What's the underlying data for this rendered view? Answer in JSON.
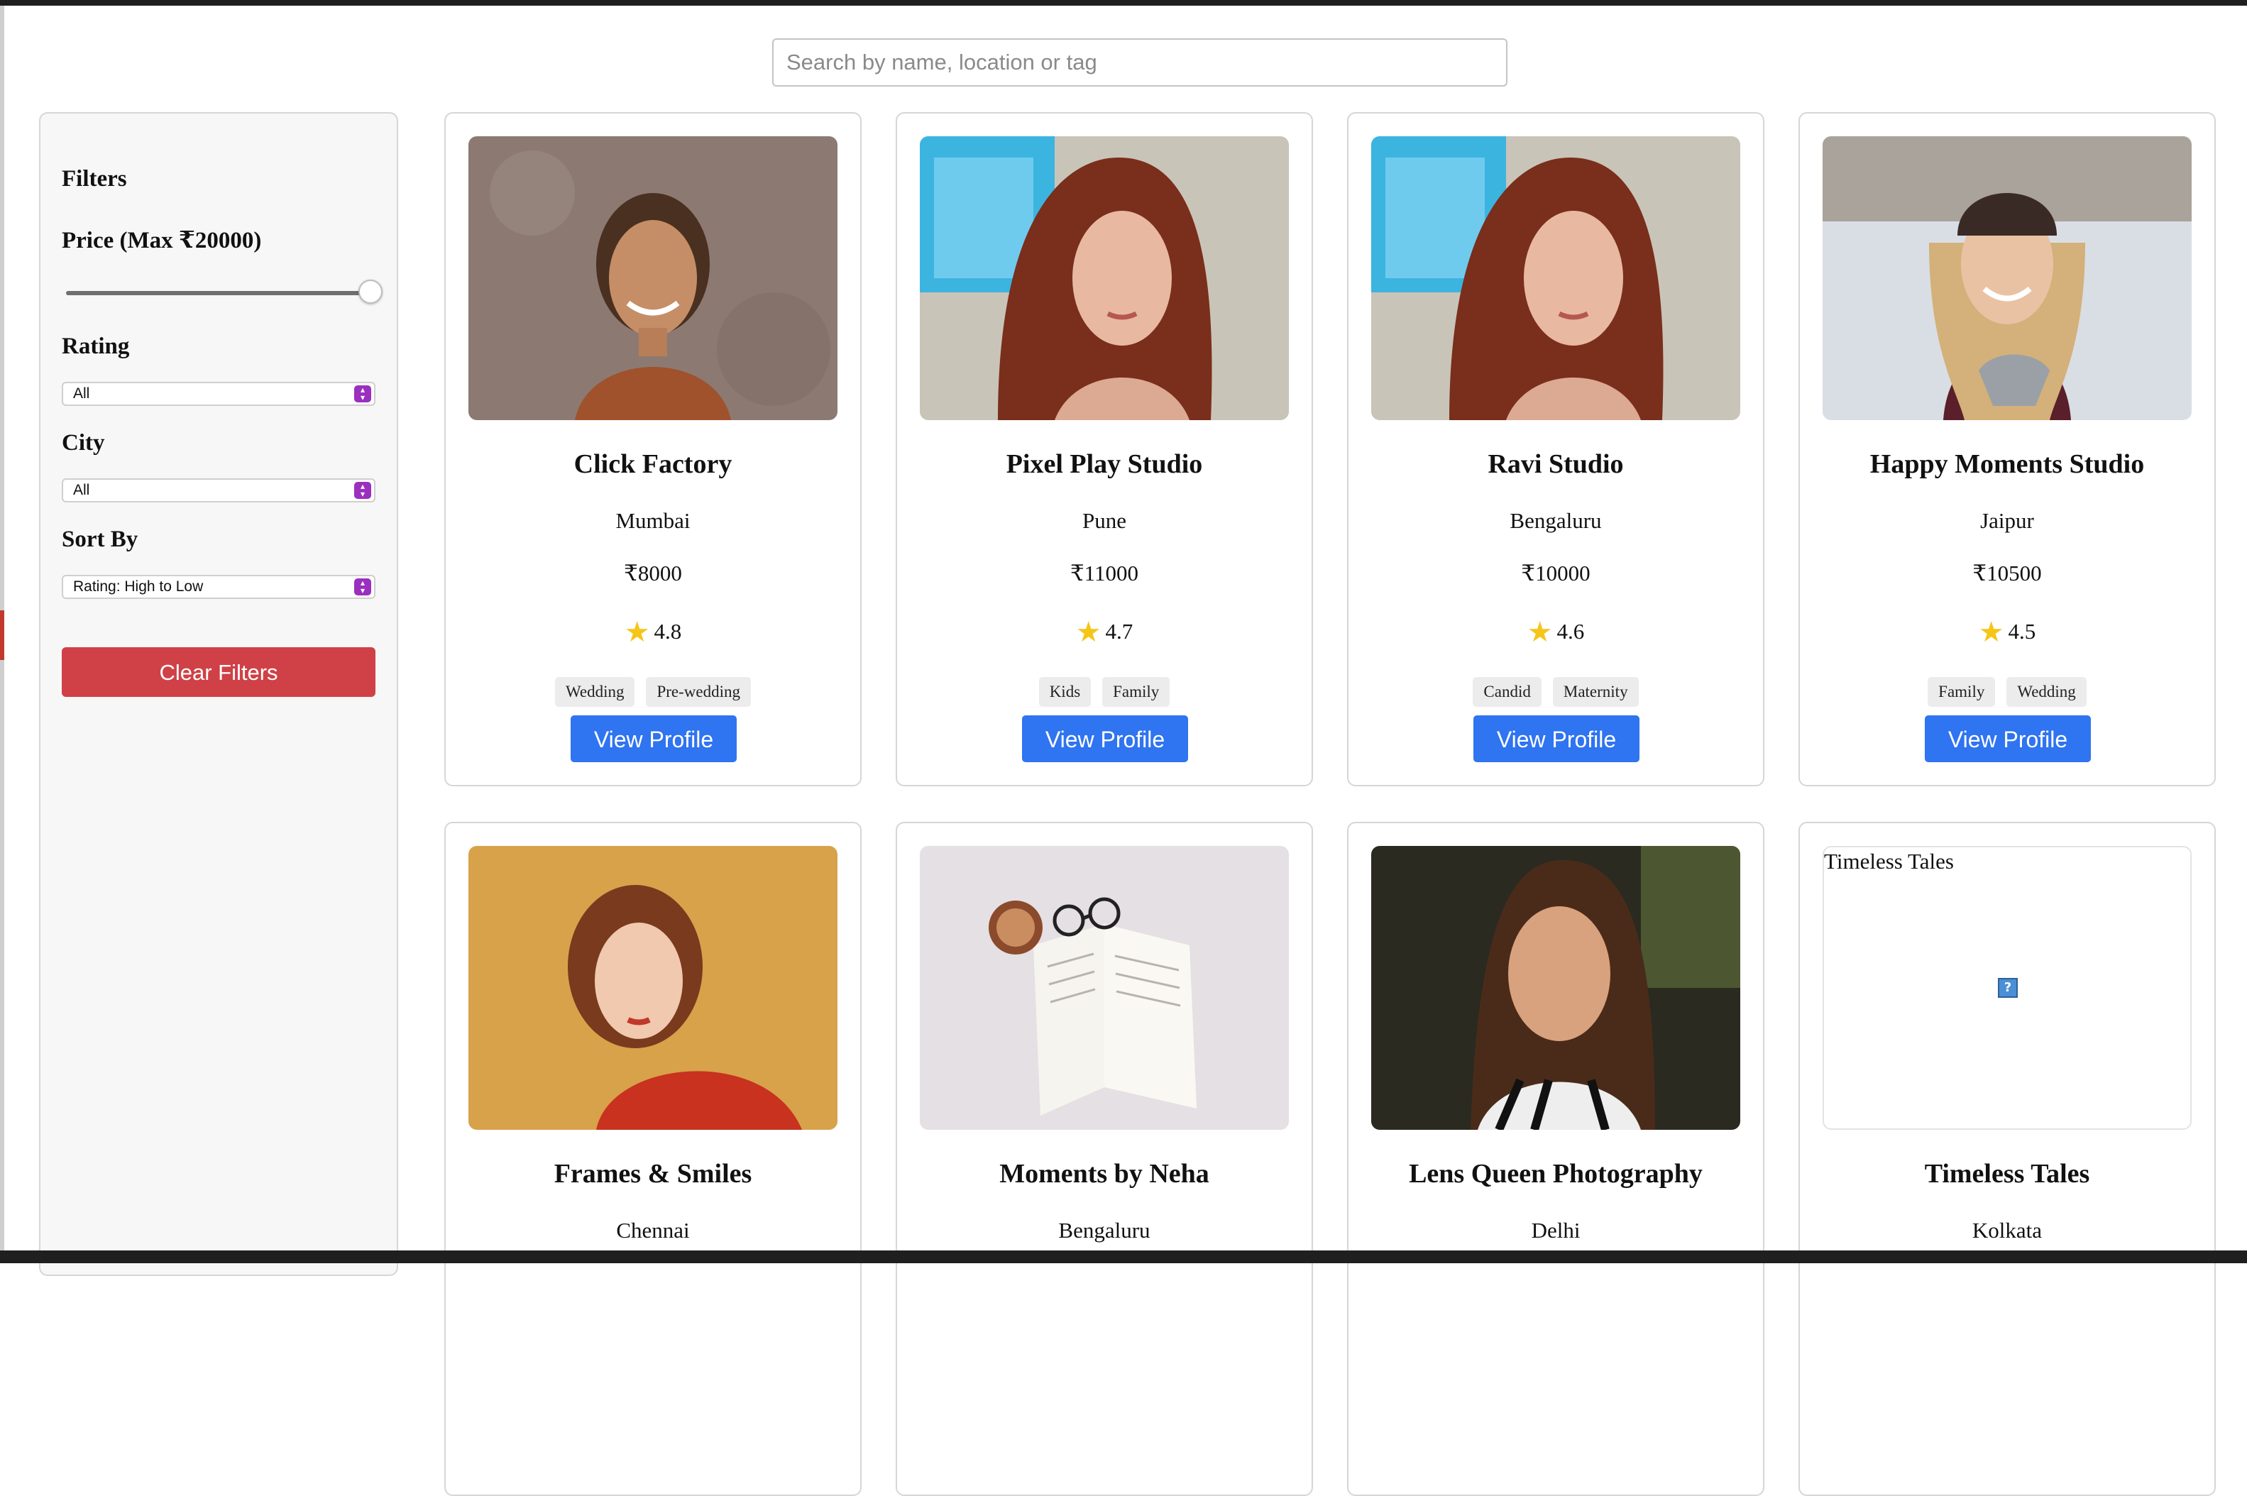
{
  "search": {
    "placeholder": "Search by name, location or tag"
  },
  "filters": {
    "heading": "Filters",
    "price_label": "Price (Max ₹20000)",
    "price_max": 20000,
    "price_value": 20000,
    "rating_label": "Rating",
    "rating_value": "All",
    "city_label": "City",
    "city_value": "All",
    "sort_label": "Sort By",
    "sort_value": "Rating: High to Low",
    "clear_label": "Clear Filters"
  },
  "colors": {
    "primary": "#2f74f0",
    "danger": "#cf4146",
    "select_accent": "#9b2fbf",
    "star": "#f5c518"
  },
  "view_label": "View Profile",
  "cards": [
    {
      "name": "Click Factory",
      "city": "Mumbai",
      "price": "₹8000",
      "rating": "4.8",
      "tags": [
        "Wedding",
        "Pre-wedding"
      ],
      "image": "woman-smiling-portrait"
    },
    {
      "name": "Pixel Play Studio",
      "city": "Pune",
      "price": "₹11000",
      "rating": "4.7",
      "tags": [
        "Kids",
        "Family"
      ],
      "image": "woman-red-hair-portrait"
    },
    {
      "name": "Ravi Studio",
      "city": "Bengaluru",
      "price": "₹10000",
      "rating": "4.6",
      "tags": [
        "Candid",
        "Maternity"
      ],
      "image": "woman-red-hair-portrait"
    },
    {
      "name": "Happy Moments Studio",
      "city": "Jaipur",
      "price": "₹10500",
      "rating": "4.5",
      "tags": [
        "Family",
        "Wedding"
      ],
      "image": "woman-beanie-snow-portrait"
    },
    {
      "name": "Frames & Smiles",
      "city": "Chennai",
      "image": "woman-curly-hair-portrait"
    },
    {
      "name": "Moments by Neha",
      "city": "Bengaluru",
      "image": "book-coffee-flatlay"
    },
    {
      "name": "Lens Queen Photography",
      "city": "Delhi",
      "image": "woman-striped-shirt-portrait"
    },
    {
      "name": "Timeless Tales",
      "city": "Kolkata",
      "image_alt": "Timeless Tales",
      "image": "broken-image"
    }
  ]
}
